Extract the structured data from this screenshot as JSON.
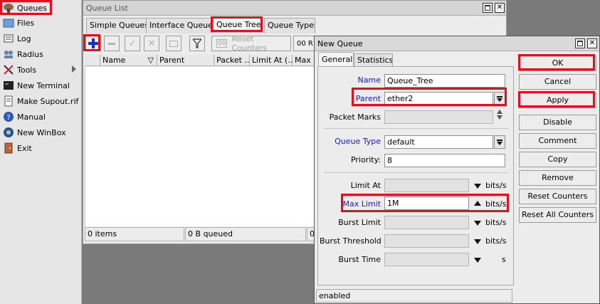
{
  "sidebar": {
    "items": [
      {
        "label": "Queues",
        "icon": "queues-icon"
      },
      {
        "label": "Files",
        "icon": "folder-icon"
      },
      {
        "label": "Log",
        "icon": "log-icon"
      },
      {
        "label": "Radius",
        "icon": "radius-icon"
      },
      {
        "label": "Tools",
        "icon": "tools-icon"
      },
      {
        "label": "New Terminal",
        "icon": "terminal-icon"
      },
      {
        "label": "Make Supout.rif",
        "icon": "supout-icon"
      },
      {
        "label": "Manual",
        "icon": "help-icon"
      },
      {
        "label": "New WinBox",
        "icon": "winbox-icon"
      },
      {
        "label": "Exit",
        "icon": "exit-icon"
      }
    ]
  },
  "queue_list": {
    "title": "Queue List",
    "tabs": [
      "Simple Queues",
      "Interface Queues",
      "Queue Tree",
      "Queue Types"
    ],
    "active_tab": "Queue Tree",
    "toolbar": {
      "reset_counters": "Reset Counters",
      "counter_icon": "00",
      "reset_all": "00 R"
    },
    "columns": [
      "Name",
      "Parent",
      "Packet ...",
      "Limit At (...",
      "Max L"
    ],
    "status": {
      "items": "0 items",
      "queued": "0 B queued",
      "extra": "0"
    }
  },
  "new_queue": {
    "title": "New Queue",
    "tabs": [
      "General",
      "Statistics"
    ],
    "fields": {
      "name": {
        "label": "Name",
        "value": "Queue_Tree"
      },
      "parent": {
        "label": "Parent",
        "value": "ether2"
      },
      "packet_marks": {
        "label": "Packet Marks",
        "value": ""
      },
      "queue_type": {
        "label": "Queue Type",
        "value": "default"
      },
      "priority": {
        "label": "Priority:",
        "value": "8"
      },
      "limit_at": {
        "label": "Limit At",
        "value": "",
        "unit": "bits/s"
      },
      "max_limit": {
        "label": "Max Limit",
        "value": "1M",
        "unit": "bits/s"
      },
      "burst_limit": {
        "label": "Burst Limit",
        "value": "",
        "unit": "bits/s"
      },
      "burst_threshold": {
        "label": "Burst Threshold",
        "value": "",
        "unit": "bits/s"
      },
      "burst_time": {
        "label": "Burst Time",
        "value": "",
        "unit": "s"
      }
    },
    "buttons": [
      "OK",
      "Cancel",
      "Apply",
      "Disable",
      "Comment",
      "Copy",
      "Remove",
      "Reset Counters",
      "Reset All Counters"
    ],
    "status": "enabled"
  },
  "colors": {
    "highlight": "#e0101c",
    "label_blue": "#1a1acc",
    "add_blue": "#1030c8"
  }
}
